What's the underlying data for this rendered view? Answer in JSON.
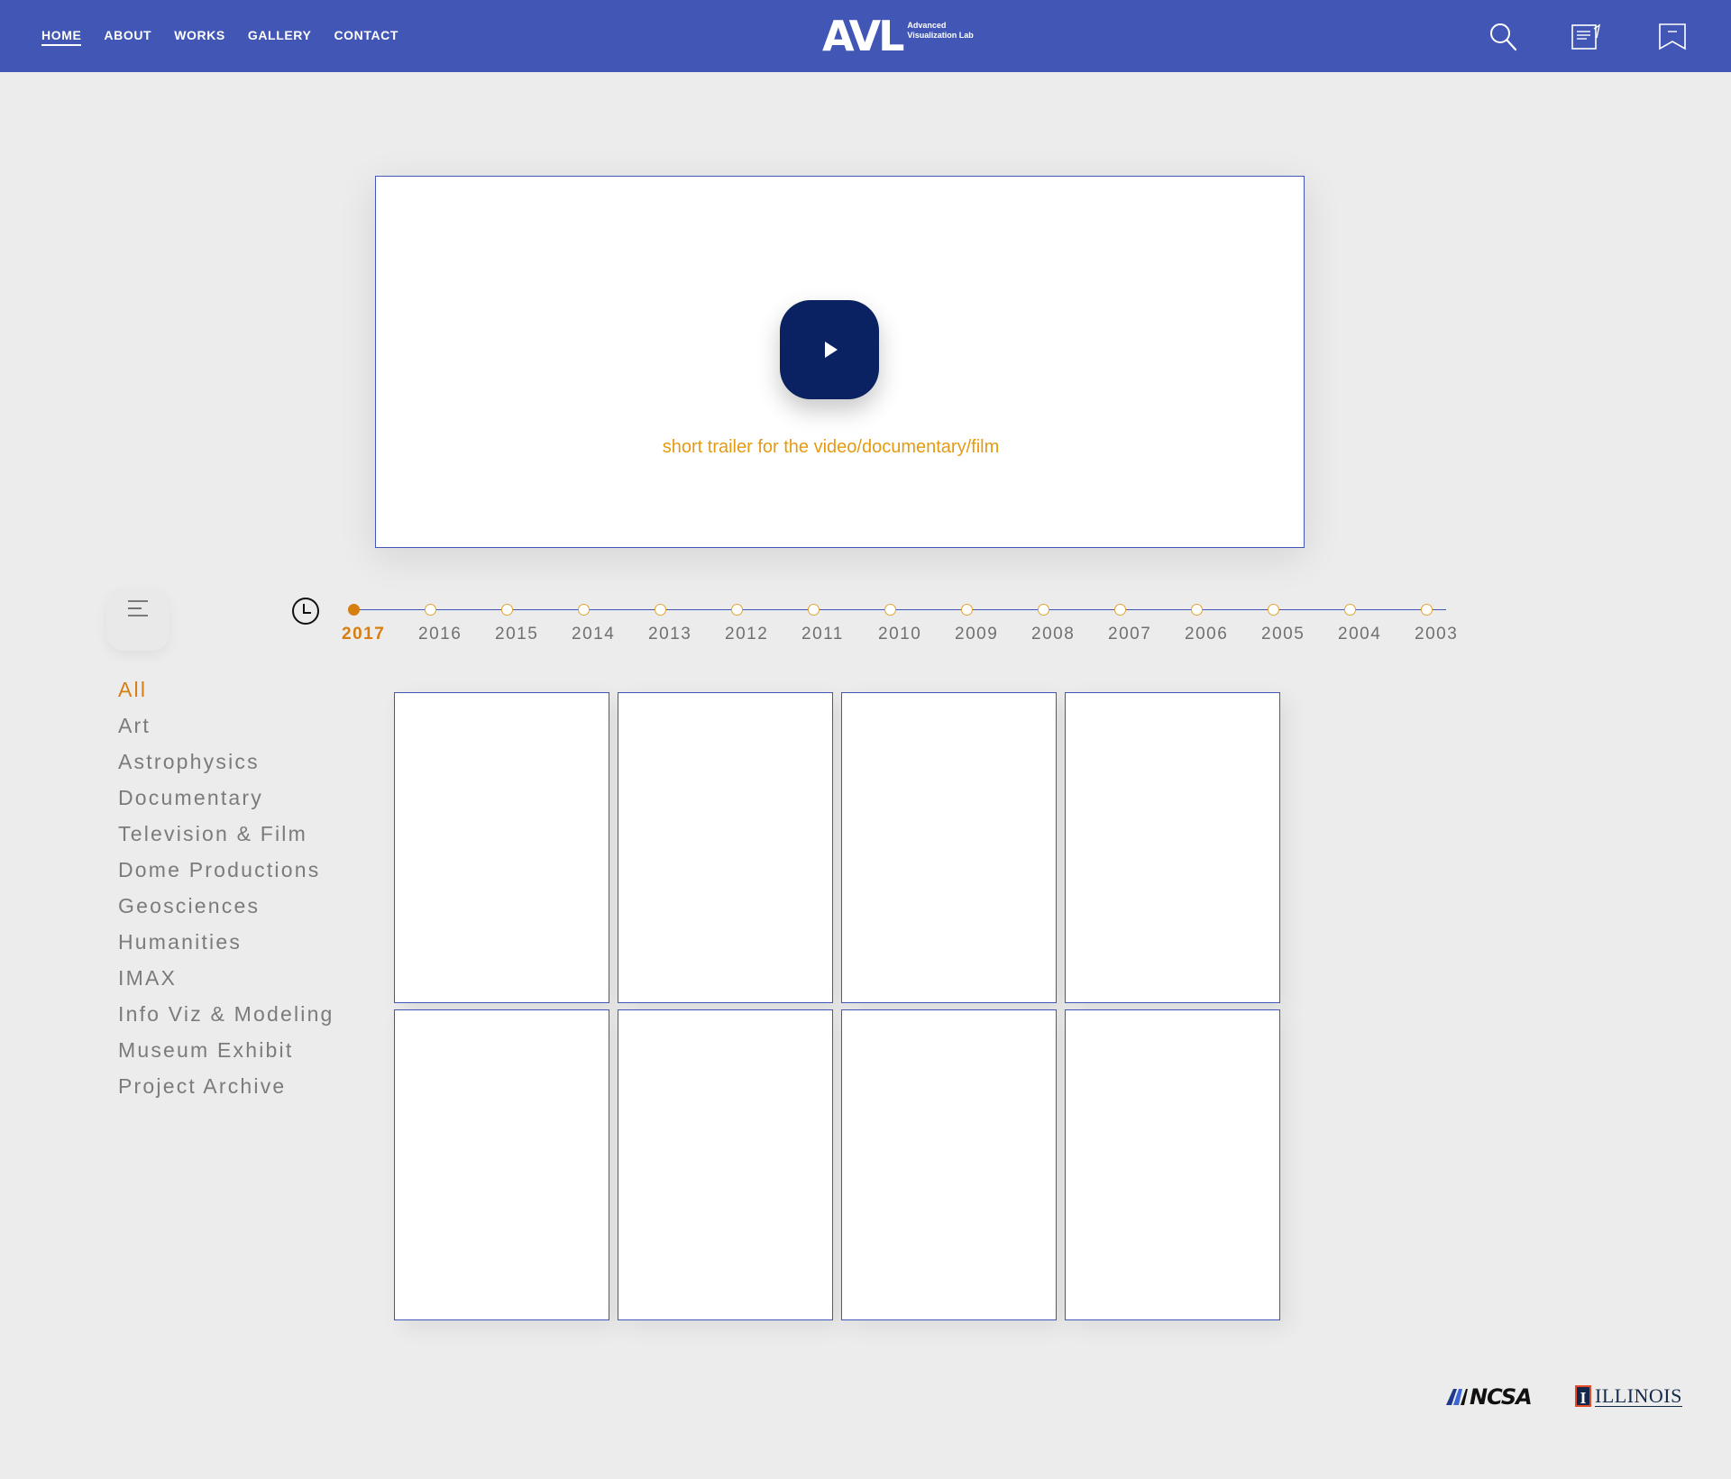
{
  "header": {
    "nav": [
      {
        "label": "HOME",
        "active": true
      },
      {
        "label": "ABOUT"
      },
      {
        "label": "WORKS"
      },
      {
        "label": "GALLERY"
      },
      {
        "label": "CONTACT"
      }
    ],
    "logo": {
      "mark": "AVL",
      "line1": "Advanced",
      "line2": "Visualization Lab"
    },
    "icons": [
      "search-icon",
      "notes-icon",
      "bookmark-icon"
    ],
    "bg_color": "#4257b5"
  },
  "video": {
    "caption": "short trailer for the video/documentary/film",
    "play_icon": "play-icon"
  },
  "timeline": {
    "years": [
      "2017",
      "2016",
      "2015",
      "2014",
      "2013",
      "2012",
      "2011",
      "2010",
      "2009",
      "2008",
      "2007",
      "2006",
      "2005",
      "2004",
      "2003"
    ],
    "selected": "2017"
  },
  "categories": {
    "items": [
      "All",
      "Art",
      "Astrophysics",
      "Documentary",
      "Television & Film",
      "Dome Productions",
      "Geosciences",
      "Humanities",
      "IMAX",
      "Info Viz & Modeling",
      "Museum Exhibit",
      "Project Archive"
    ],
    "selected": "All"
  },
  "grid": {
    "cards": 8
  },
  "footer": {
    "ncsa": "NCSA",
    "illinois": "ILLINOIS"
  },
  "colors": {
    "accent": "#d67e10",
    "caption": "#e49b12",
    "primary": "#4257b5",
    "play": "#0a2261"
  }
}
